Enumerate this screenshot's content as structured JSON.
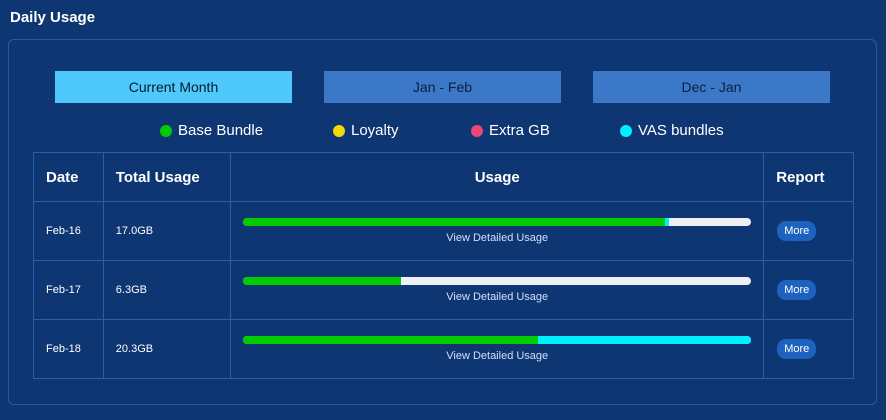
{
  "page": {
    "title": "Daily Usage"
  },
  "tabs": [
    {
      "label": "Current Month",
      "active": true
    },
    {
      "label": "Jan - Feb",
      "active": false
    },
    {
      "label": "Dec - Jan",
      "active": false
    }
  ],
  "legend": [
    {
      "label": "Base Bundle",
      "color": "#00cc00"
    },
    {
      "label": "Loyalty",
      "color": "#f5d800"
    },
    {
      "label": "Extra GB",
      "color": "#ee4477"
    },
    {
      "label": "VAS bundles",
      "color": "#00f0ff"
    }
  ],
  "table": {
    "headers": {
      "date": "Date",
      "total": "Total Usage",
      "usage": "Usage",
      "report": "Report"
    },
    "rows": [
      {
        "date": "Feb-16",
        "total": "17.0GB",
        "link": "View Detailed Usage",
        "button": "More",
        "usage": {
          "base": 0.83,
          "vas": 0.008
        }
      },
      {
        "date": "Feb-17",
        "total": "6.3GB",
        "link": "View Detailed Usage",
        "button": "More",
        "usage": {
          "base": 0.31,
          "vas": 0
        }
      },
      {
        "date": "Feb-18",
        "total": "20.3GB",
        "link": "View Detailed Usage",
        "button": "More",
        "usage": {
          "base": 0.58,
          "vas": 0.42
        }
      }
    ]
  }
}
